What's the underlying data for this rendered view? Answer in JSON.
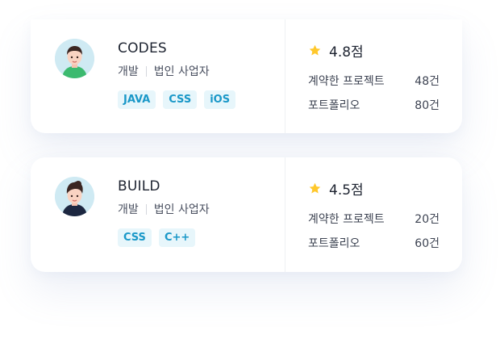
{
  "cards": [
    {
      "name": "CODES",
      "category": "개발",
      "business_type": "법인 사업자",
      "tags": [
        "JAVA",
        "CSS",
        "iOS"
      ],
      "rating": "4.8점",
      "stats": [
        {
          "label": "계약한 프로젝트",
          "value": "48건"
        },
        {
          "label": "포트폴리오",
          "value": "80건"
        }
      ],
      "avatar": {
        "icon": "avatar-short-hair-green-shirt-icon",
        "bg": "#cfeaf3",
        "shirt": "#3cba6f",
        "hair": "#3a2622"
      }
    },
    {
      "name": "BUILD",
      "category": "개발",
      "business_type": "법인 사업자",
      "tags": [
        "CSS",
        "C++"
      ],
      "rating": "4.5점",
      "stats": [
        {
          "label": "계약한 프로젝트",
          "value": "20건"
        },
        {
          "label": "포트폴리오",
          "value": "60건"
        }
      ],
      "avatar": {
        "icon": "avatar-curly-hair-navy-shirt-icon",
        "bg": "#cfeaf3",
        "shirt": "#1c2740",
        "hair": "#3a2622"
      }
    }
  ],
  "colors": {
    "tag_bg": "#e7f6fb",
    "tag_text": "#1a98c8",
    "star": "#ffc82c",
    "text_primary": "#1d2330",
    "text_secondary": "#4a5060"
  },
  "icons": {
    "star": "star-icon"
  }
}
